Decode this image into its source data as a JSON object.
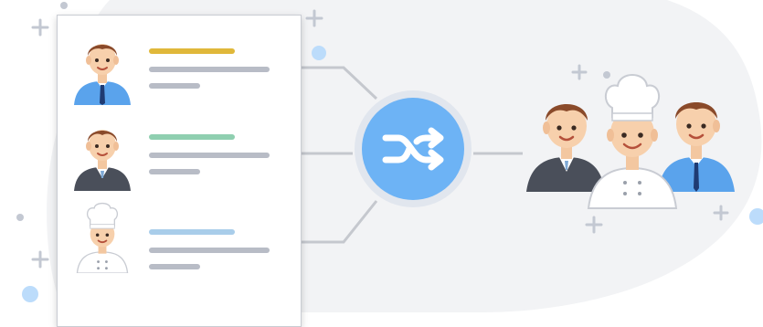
{
  "diagram": {
    "profile_rows": [
      {
        "role": "businessman-blue",
        "title_bar_color": "#e0b83a"
      },
      {
        "role": "businessman-suit",
        "title_bar_color": "#8fcfb0"
      },
      {
        "role": "chef",
        "title_bar_color": "#a9cdea"
      }
    ],
    "center_icon": "shuffle-icon",
    "team_members": [
      "businessman-suit",
      "chef",
      "businessman-blue"
    ]
  },
  "colors": {
    "accent_blue": "#6db3f5",
    "connector": "#c5c8ce",
    "background_blob": "#f1f2f4"
  }
}
